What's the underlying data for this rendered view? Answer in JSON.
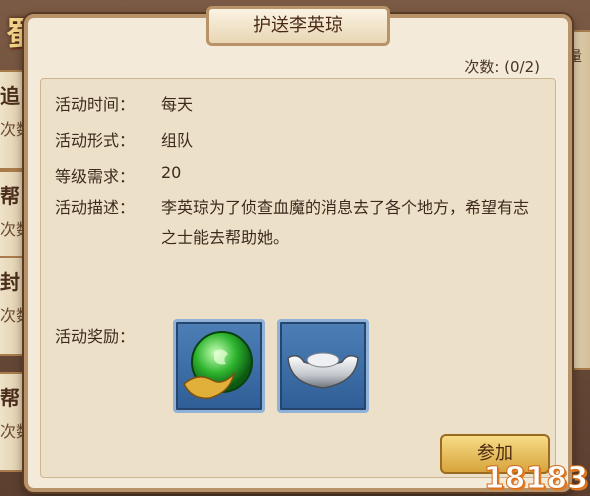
{
  "background": {
    "logo_text": "蜀门",
    "left_cards": [
      {
        "title": "追",
        "sub": "次数"
      },
      {
        "title": "帮",
        "sub": "次数"
      },
      {
        "title": "封",
        "sub": "次数"
      },
      {
        "title": "帮",
        "sub": "次数"
      }
    ],
    "right_tab_text": "量"
  },
  "dialog": {
    "title": "护送李英琼",
    "count": "次数: (0/2)",
    "fields": {
      "time_label": "活动时间：",
      "time_value": "每天",
      "form_label": "活动形式：",
      "form_value": "组队",
      "level_label": "等级需求：",
      "level_value": "20",
      "desc_label": "活动描述：",
      "desc_value": "李英琼为了侦查血魔的消息去了各个地方，希望有志之士能去帮助她。",
      "reward_label": "活动奖励："
    },
    "rewards": [
      {
        "icon": "green-orb-icon"
      },
      {
        "icon": "silver-ingot-icon"
      }
    ],
    "join_button": "参加"
  },
  "watermark": "18183",
  "colors": {
    "dialog_bg": "#f3ead9",
    "border": "#b8936a",
    "slot_blue": "#2f5e96",
    "button_gold": "#d7a43c"
  }
}
